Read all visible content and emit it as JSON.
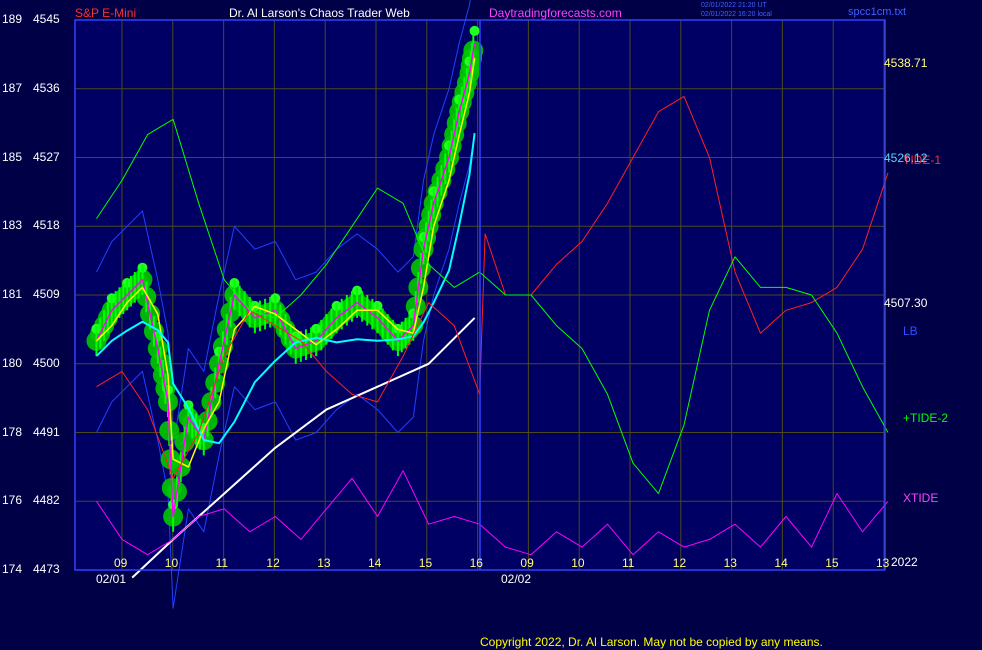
{
  "header": {
    "instrument": "S&P E-Mini",
    "title": "Dr. Al Larson's Chaos Trader Web",
    "website": "Daytradingforecasts.com",
    "timestamp_ut": "02/01/2022 21:20 UT",
    "timestamp_local": "02/01/2022 16:20 local",
    "filename": "spcc1cm.txt"
  },
  "colors": {
    "background": "#000046",
    "plot_bg": "#000064",
    "price_bar": "#00ff00",
    "glow": "#00c800",
    "glow_bright": "#22ff22",
    "fast_avg": "#ffff00",
    "mid_avg": "#00ffff",
    "slow_avg": "#ffffff",
    "wave": "#ff00ff",
    "tide1": "#ff2020",
    "tide2": "#00ff00",
    "xtide": "#ff00ff",
    "band": "#2040ff",
    "axis": "#3040ff",
    "label": "#ffffff",
    "price_label": "#ffff80",
    "copyright": "#ffff00"
  },
  "y_axis": {
    "left_labels": [
      {
        "a": "189",
        "b": "4545"
      },
      {
        "a": "187",
        "b": "4536"
      },
      {
        "a": "185",
        "b": "4527"
      },
      {
        "a": "183",
        "b": "4518"
      },
      {
        "a": "181",
        "b": "4509"
      },
      {
        "a": "180",
        "b": "4500"
      },
      {
        "a": "178",
        "b": "4491"
      },
      {
        "a": "176",
        "b": "4482"
      },
      {
        "a": "174",
        "b": "4473"
      }
    ],
    "price_range": [
      4473,
      4545
    ]
  },
  "x_axis": {
    "hour_labels": [
      "09",
      "10",
      "11",
      "12",
      "13",
      "14",
      "15",
      "16",
      "09",
      "10",
      "11",
      "12",
      "13",
      "14",
      "15",
      "13"
    ],
    "date_labels": [
      "02/01",
      "02/02"
    ],
    "year_label": "2022"
  },
  "right_labels": {
    "price_high": "4538.71",
    "price_mid": "4526.12",
    "price_low": "4507.30",
    "tide1": "TIDE-1",
    "lb": "LB",
    "tide2": "+TIDE-2",
    "xtide": "XTIDE"
  },
  "copyright": "Copyright 2022, Dr. Al Larson. May not be copied by any means.",
  "chart_data": {
    "type": "line",
    "x_unit": "hour of session",
    "y_unit": "S&P E-Mini price",
    "ylim": [
      4473,
      4545
    ],
    "grid": true,
    "series": [
      {
        "name": "S&P E-Mini",
        "kind": "price bars",
        "x": [
          8.5,
          8.8,
          9.1,
          9.4,
          9.7,
          9.9,
          10.0,
          10.3,
          10.6,
          10.9,
          11.2,
          11.6,
          12.0,
          12.4,
          12.8,
          13.2,
          13.6,
          14.0,
          14.4,
          14.7,
          14.9,
          15.1,
          15.4,
          15.6,
          15.8,
          15.9
        ],
        "y": [
          4503,
          4507,
          4509,
          4511,
          4502,
          4495,
          4480,
          4493,
          4490,
          4500,
          4509,
          4506,
          4507,
          4502,
          4503,
          4506,
          4508,
          4506,
          4503,
          4505,
          4515,
          4521,
          4527,
          4533,
          4538,
          4542
        ]
      },
      {
        "name": "TIDE-1",
        "x": [
          8.5,
          9.0,
          9.5,
          10.0,
          10.5,
          11.0,
          11.5,
          12.0,
          12.5,
          13.0,
          13.5,
          14.0,
          14.5,
          15.0,
          15.5,
          16.0,
          16.1,
          16.5,
          17.0,
          17.5,
          18.0,
          18.5,
          19.0,
          19.5,
          20.0,
          20.5,
          21.0,
          21.5,
          22.0,
          22.5,
          23.0,
          23.5,
          24.0
        ],
        "y": [
          4497,
          4499,
          4494,
          4485,
          4491,
          4501,
          4507,
          4505,
          4503,
          4499,
          4496,
          4495,
          4501,
          4508,
          4505,
          4496,
          4517,
          4509,
          4509,
          4513,
          4516,
          4521,
          4527,
          4533,
          4535,
          4527,
          4512,
          4504,
          4507,
          4508,
          4510,
          4515,
          4525
        ]
      },
      {
        "name": "+TIDE-2",
        "x": [
          8.5,
          9.0,
          9.5,
          10.0,
          10.5,
          11.0,
          11.5,
          12.0,
          12.5,
          13.0,
          13.5,
          14.0,
          14.5,
          15.0,
          15.5,
          16.0,
          16.5,
          17.0,
          17.5,
          18.0,
          18.5,
          19.0,
          19.5,
          20.0,
          20.5,
          21.0,
          21.5,
          22.0,
          22.5,
          23.0,
          23.5,
          24.0
        ],
        "y": [
          4519,
          4524,
          4530,
          4532,
          4521,
          4511,
          4507,
          4506,
          4509,
          4513,
          4518,
          4523,
          4521,
          4513,
          4510,
          4512,
          4509,
          4509,
          4505,
          4502,
          4496,
          4487,
          4483,
          4492,
          4507,
          4514,
          4510,
          4510,
          4509,
          4504,
          4497,
          4491
        ]
      },
      {
        "name": "XTIDE",
        "x": [
          8.5,
          9.0,
          9.5,
          10.0,
          10.5,
          11.0,
          11.5,
          12.0,
          12.5,
          13.0,
          13.5,
          14.0,
          14.5,
          15.0,
          15.5,
          16.0,
          16.5,
          17.0,
          17.5,
          18.0,
          18.5,
          19.0,
          19.5,
          20.0,
          20.5,
          21.0,
          21.5,
          22.0,
          22.5,
          23.0,
          23.5,
          24.0
        ],
        "y": [
          4482,
          4477,
          4475,
          4477,
          4480,
          4481,
          4478,
          4480,
          4477,
          4481,
          4485,
          4480,
          4486,
          4479,
          4480,
          4479,
          4476,
          4475,
          4478,
          4476,
          4479,
          4475,
          4478,
          4476,
          4477,
          4479,
          4476,
          4480,
          4476,
          4483,
          4478,
          4482
        ]
      }
    ]
  }
}
